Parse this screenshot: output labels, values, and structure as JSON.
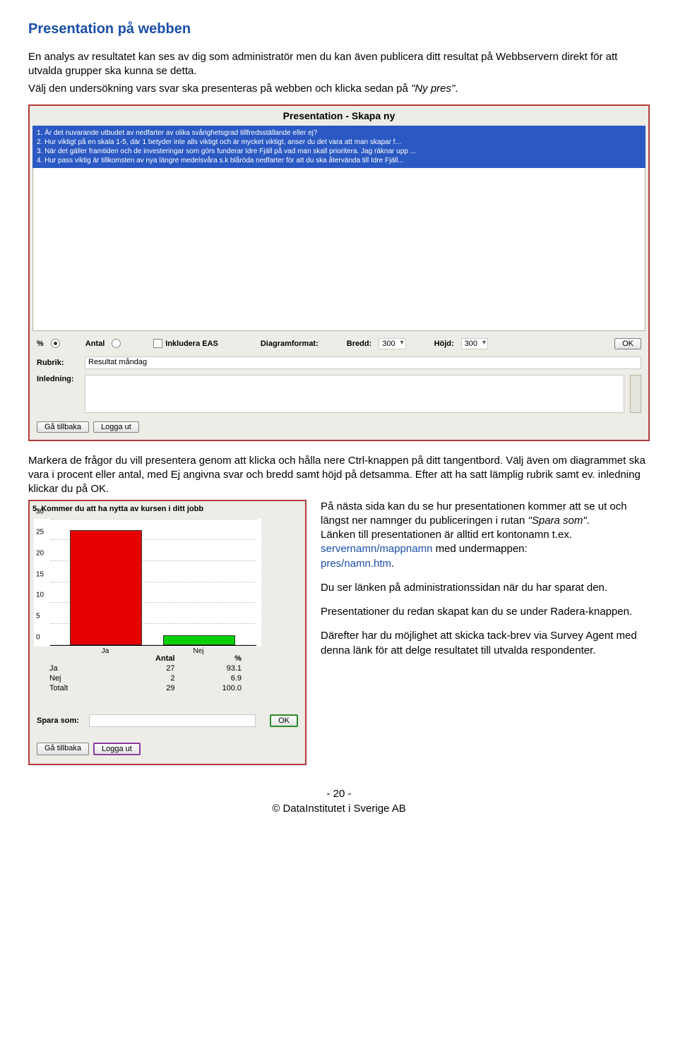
{
  "heading": "Presentation på webben",
  "intro1": "En analys av resultatet kan ses av dig som administratör men du kan även publicera ditt resultat på Webbservern direkt för att utvalda grupper ska kunna se detta.",
  "intro2a": "Välj den undersökning vars svar ska presenteras på webben och klicka sedan på ",
  "intro2b": "\"Ny pres\"",
  "intro2c": ".",
  "app1": {
    "title": "Presentation - Skapa ny",
    "questions": [
      "1. Är det nuvarande utbudet av nedfarter av olika svårighetsgrad tillfredsställande eller ej?",
      "2. Hur viktigt på en skala 1-5, där 1 betyder inte alls viktigt och är mycket viktigt, anser du det vara att man skapar f...",
      "3. När det gäller framtiden och de investeringar som görs funderar Idre Fjäll på vad man skall prioritera. Jag räknar upp ...",
      "4. Hur pass viktig är tillkomsten av nya längre medelsvåra s.k blåröda nedfarter för att du ska återvända till Idre Fjäll..."
    ],
    "percentLabel": "%",
    "antalLabel": "Antal",
    "easLabel": "Inkludera EAS",
    "diagLabel": "Diagramformat:",
    "breddLabel": "Bredd:",
    "breddVal": "300",
    "hojdLabel": "Höjd:",
    "hojdVal": "300",
    "okLabel": "OK",
    "rubrikLabel": "Rubrik:",
    "rubrikVal": "Resultat måndag",
    "inledLabel": "Inledning:",
    "backLabel": "Gå tillbaka",
    "logoutLabel": "Logga ut"
  },
  "mid": "Markera de frågor du vill presentera genom att klicka och hålla nere Ctrl-knappen på ditt tangentbord. Välj även om diagrammet ska vara i procent eller antal, med Ej angivna svar och bredd samt höjd på detsamma. Efter att ha satt lämplig rubrik samt ev. inledning klickar du på OK.",
  "app2": {
    "title": "5. Kommer du att ha nytta av kursen i ditt jobb",
    "headAntal": "Antal",
    "headPct": "%",
    "rows": [
      {
        "name": "Ja",
        "antal": "27",
        "pct": "93.1"
      },
      {
        "name": "Nej",
        "antal": "2",
        "pct": "6.9"
      },
      {
        "name": "Totalt",
        "antal": "29",
        "pct": "100.0"
      }
    ],
    "saveLabel": "Spara som:",
    "okLabel": "OK",
    "backLabel": "Gå tillbaka",
    "logoutLabel": "Logga ut"
  },
  "chart_data": {
    "type": "bar",
    "categories": [
      "Ja",
      "Nej"
    ],
    "values": [
      27,
      2
    ],
    "title": "5. Kommer du att ha nytta av kursen i ditt jobb",
    "xlabel": "",
    "ylabel": "",
    "ylim": [
      0,
      30
    ],
    "yticks": [
      0,
      5,
      10,
      15,
      20,
      25,
      30
    ]
  },
  "right": {
    "p1a": "På nästa sida kan du se hur presentationen kommer att se ut och längst ner namnger du publiceringen i rutan ",
    "p1b": "\"Spara som\"",
    "p1c": ".",
    "p1d": "Länken till presentationen är alltid ert kontonamn t.ex. ",
    "p1e": "servernamn/mappnamn",
    "p1f": " med undermappen:",
    "p1g": "pres/namn.htm",
    "p1h": ".",
    "p2": "Du ser länken på administrationssidan när du har sparat den.",
    "p3": "Presentationer du redan skapat kan du se under Radera-knappen.",
    "p4": "Därefter har du möjlighet att skicka tack-brev via Survey Agent med denna länk för att delge resultatet till utvalda respondenter."
  },
  "footer": {
    "page": "- 20 -",
    "copy": "© DataInstitutet i Sverige AB"
  }
}
